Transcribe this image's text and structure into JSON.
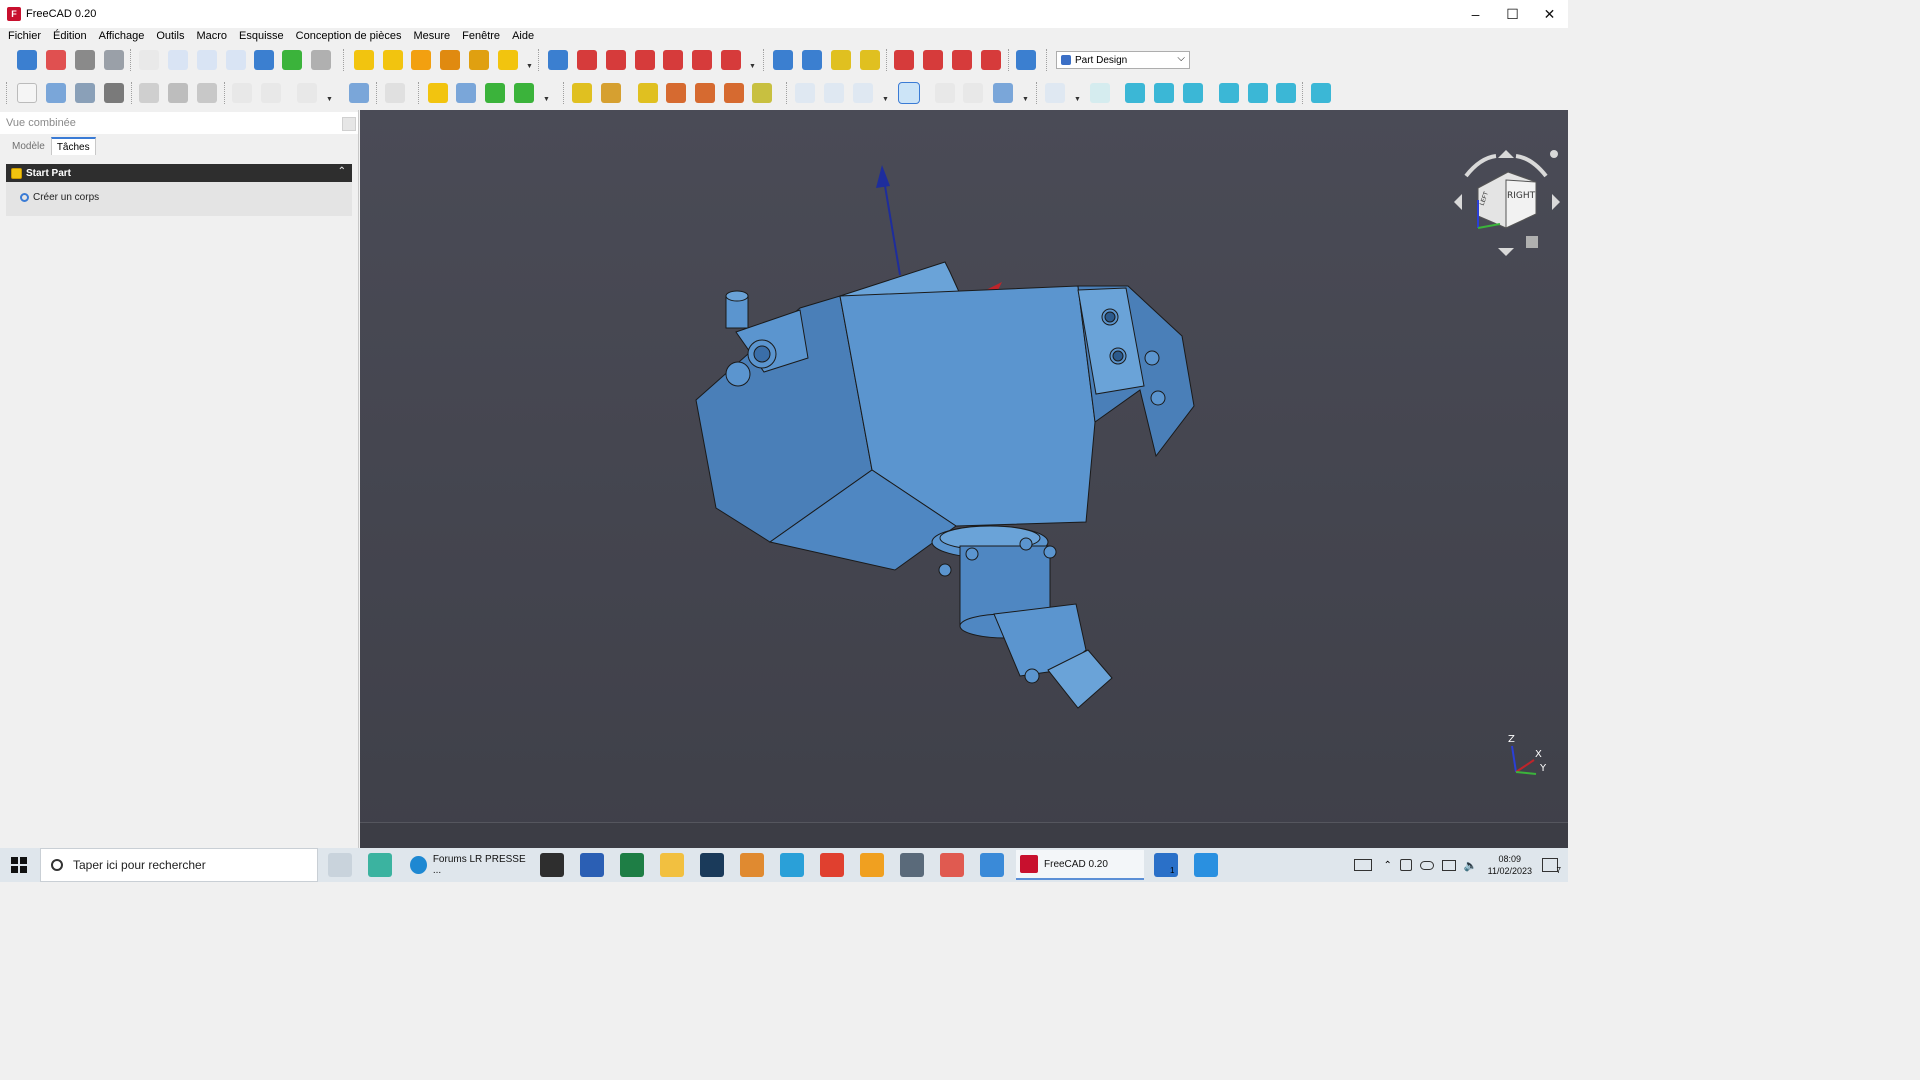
{
  "window": {
    "title": "FreeCAD 0.20",
    "controls": [
      "minimize",
      "maximize",
      "close"
    ]
  },
  "menu": [
    "Fichier",
    "Édition",
    "Affichage",
    "Outils",
    "Macro",
    "Esquisse",
    "Conception de pièces",
    "Mesure",
    "Fenêtre",
    "Aide"
  ],
  "workbench": {
    "selected": "Part Design"
  },
  "left_panel": {
    "header": "Vue combinée",
    "tabs": [
      {
        "label": "Modèle",
        "active": false
      },
      {
        "label": "Tâches",
        "active": true
      }
    ],
    "task_box": {
      "title": "Start Part",
      "item": "Créer un corps"
    }
  },
  "view3d": {
    "navcube_face": "RIGHT",
    "navcube_side": "LEFT",
    "axis_labels": {
      "z": "Z",
      "x": "X",
      "y": "Y"
    }
  },
  "taskbar": {
    "search_placeholder": "Taper ici pour rechercher",
    "tasks": [
      {
        "label": "Forums LR PRESSE ...",
        "active": false
      },
      {
        "label": "FreeCAD 0.20",
        "active": true
      }
    ],
    "clock": {
      "time": "08:09",
      "date": "11/02/2023"
    },
    "notification_count": "7",
    "badge": "1"
  },
  "colors": {
    "model_face": "#5b95cf",
    "model_edge": "#1a1a1a",
    "view_bg": "#45464f",
    "accent": "#3a7bd5"
  }
}
